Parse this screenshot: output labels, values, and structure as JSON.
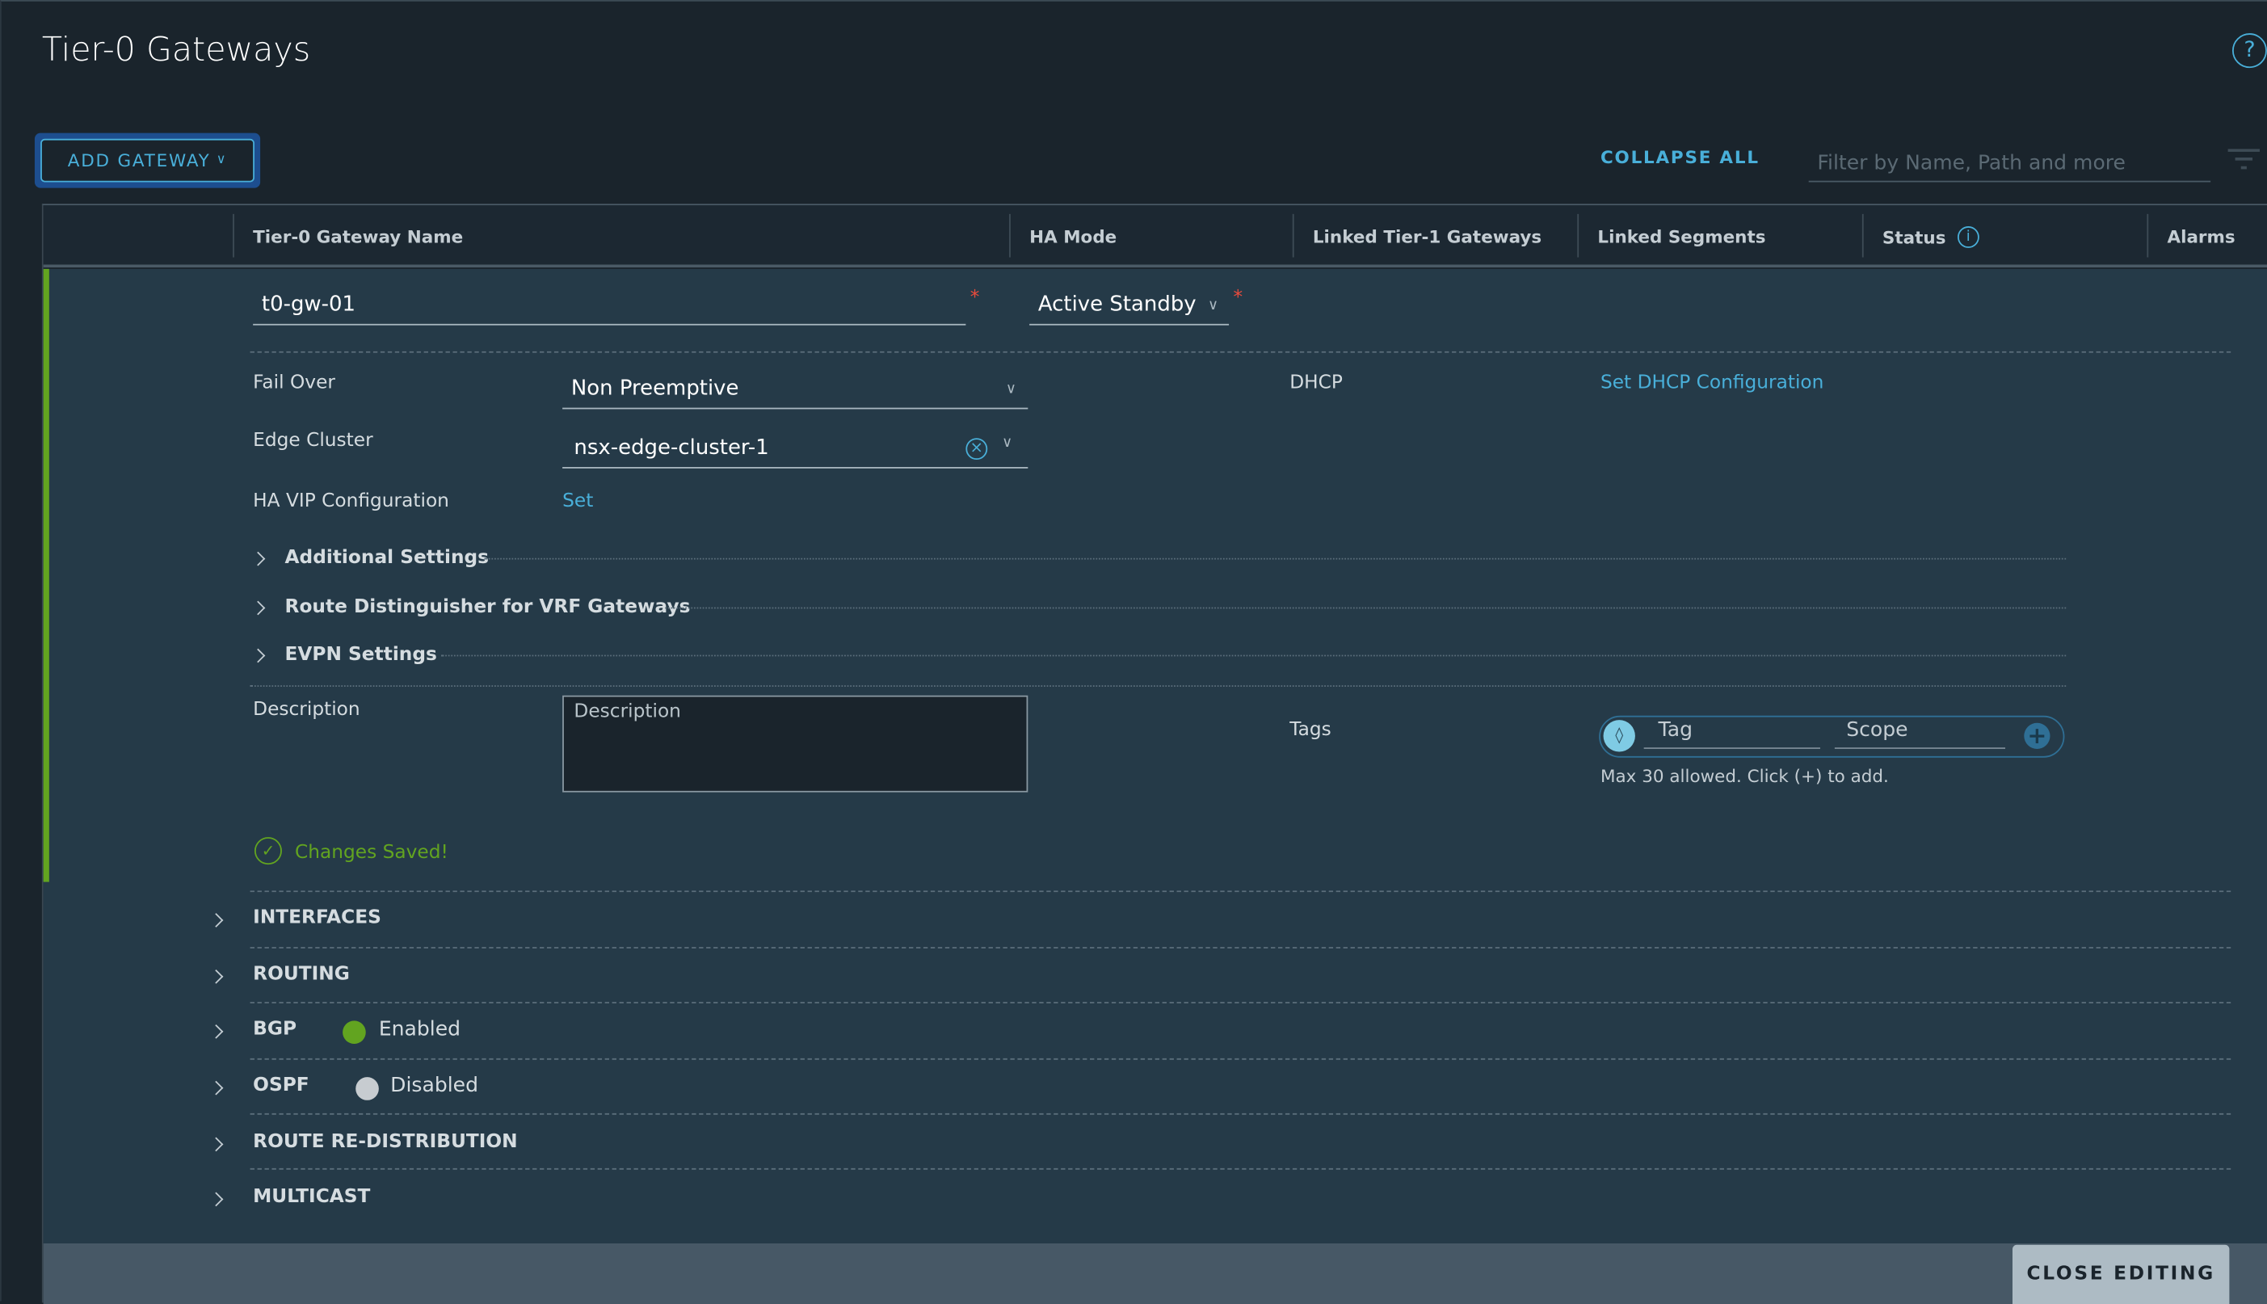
{
  "page": {
    "title": "Tier-0 Gateways"
  },
  "toolbar": {
    "add_gateway": "ADD GATEWAY",
    "collapse_all": "COLLAPSE ALL",
    "filter_placeholder": "Filter by Name, Path and more"
  },
  "table": {
    "columns": [
      "Tier-0 Gateway Name",
      "HA Mode",
      "Linked Tier-1 Gateways",
      "Linked Segments",
      "Status",
      "Alarms"
    ]
  },
  "editor": {
    "name_value": "t0-gw-01",
    "ha_mode_value": "Active Standby",
    "required_mark": "*",
    "fail_over": {
      "label": "Fail Over",
      "value": "Non Preemptive"
    },
    "edge_cluster": {
      "label": "Edge Cluster",
      "value": "nsx-edge-cluster-1"
    },
    "ha_vip": {
      "label": "HA VIP Configuration",
      "link": "Set"
    },
    "dhcp": {
      "label": "DHCP",
      "link": "Set DHCP Configuration"
    },
    "collapsibles": [
      "Additional Settings",
      "Route Distinguisher for VRF Gateways",
      "EVPN Settings"
    ],
    "description": {
      "label": "Description",
      "placeholder": "Description"
    },
    "tags": {
      "label": "Tags",
      "tag_placeholder": "Tag",
      "scope_placeholder": "Scope",
      "hint": "Max 30 allowed. Click (+) to add."
    },
    "saved_message": "Changes Saved!"
  },
  "sections": [
    {
      "label": "INTERFACES"
    },
    {
      "label": "ROUTING"
    },
    {
      "label": "BGP",
      "status": "Enabled",
      "status_color": "#62a420"
    },
    {
      "label": "OSPF",
      "status": "Disabled",
      "status_color": "#c7ccd0"
    },
    {
      "label": "ROUTE RE-DISTRIBUTION"
    },
    {
      "label": "MULTICAST"
    }
  ],
  "footer": {
    "close_editing": "CLOSE EDITING"
  },
  "colors": {
    "accent": "#49afd9",
    "success": "#62a420",
    "required": "#e84b3c"
  }
}
